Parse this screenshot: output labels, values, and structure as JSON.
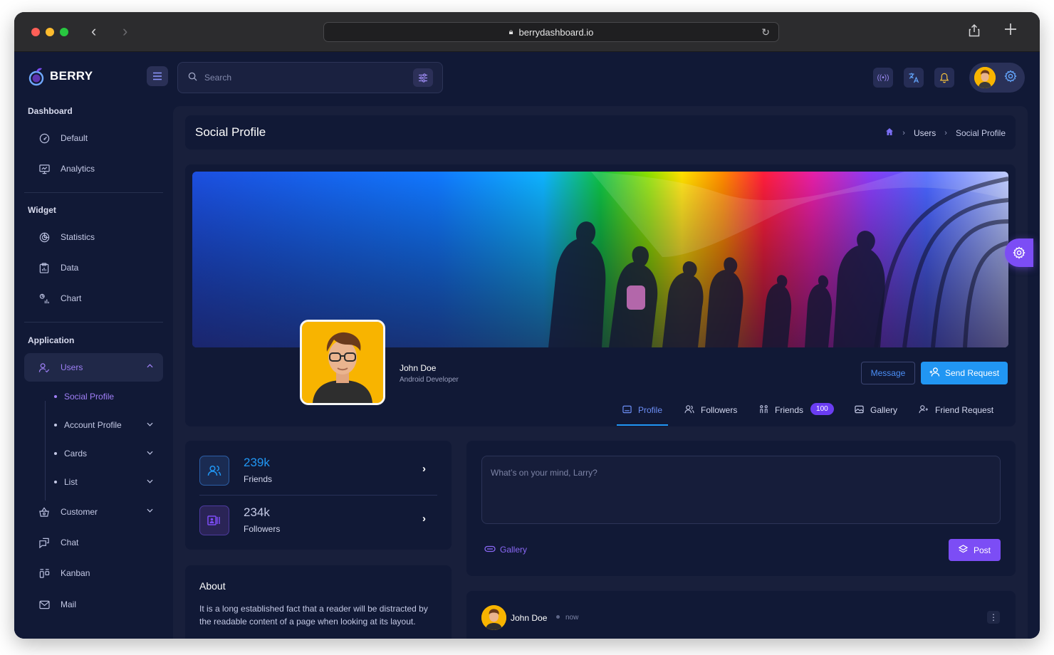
{
  "browser": {
    "url": "berrydashboard.io"
  },
  "brand": {
    "name": "BERRY",
    "accent": "#7c4df5",
    "primary": "#2196f3"
  },
  "header": {
    "search_placeholder": "Search"
  },
  "sidebar": {
    "sections": [
      {
        "title": "Dashboard",
        "items": [
          {
            "label": "Default",
            "icon": "dashboard-icon"
          },
          {
            "label": "Analytics",
            "icon": "device-analytics-icon"
          }
        ]
      },
      {
        "title": "Widget",
        "items": [
          {
            "label": "Statistics",
            "icon": "statistics-icon"
          },
          {
            "label": "Data",
            "icon": "clipboard-data-icon"
          },
          {
            "label": "Chart",
            "icon": "chart-icon"
          }
        ]
      },
      {
        "title": "Application",
        "items": [
          {
            "label": "Users",
            "icon": "users-icon"
          },
          {
            "label": "Customer",
            "icon": "basket-icon"
          },
          {
            "label": "Chat",
            "icon": "chat-icon"
          },
          {
            "label": "Kanban",
            "icon": "kanban-icon"
          },
          {
            "label": "Mail",
            "icon": "mail-icon"
          }
        ]
      }
    ],
    "users_sub": [
      "Social Profile",
      "Account Profile",
      "Cards",
      "List"
    ]
  },
  "page": {
    "title": "Social Profile",
    "breadcrumbs": [
      "Users",
      "Social Profile"
    ]
  },
  "profile": {
    "name": "John Doe",
    "role": "Android Developer",
    "message_label": "Message",
    "request_label": "Send Request",
    "tabs": [
      {
        "label": "Profile",
        "icon": "profile-card-icon"
      },
      {
        "label": "Followers",
        "icon": "followers-icon"
      },
      {
        "label": "Friends",
        "icon": "friends-icon",
        "badge": "100"
      },
      {
        "label": "Gallery",
        "icon": "gallery-icon"
      },
      {
        "label": "Friend Request",
        "icon": "friend-request-icon"
      }
    ]
  },
  "stats": [
    {
      "value": "239k",
      "label": "Friends",
      "icon": "users-icon",
      "color": "#2196f3"
    },
    {
      "value": "234k",
      "label": "Followers",
      "icon": "followers-card-icon",
      "color": "#7c4df5"
    }
  ],
  "about": {
    "title": "About",
    "text": "It is a long established fact that a reader will be distracted by the readable content of a page when looking at its layout."
  },
  "composer": {
    "placeholder": "What’s on your mind, Larry?",
    "gallery_label": "Gallery",
    "post_label": "Post"
  },
  "feed": {
    "author": "John Doe",
    "time": "now"
  }
}
